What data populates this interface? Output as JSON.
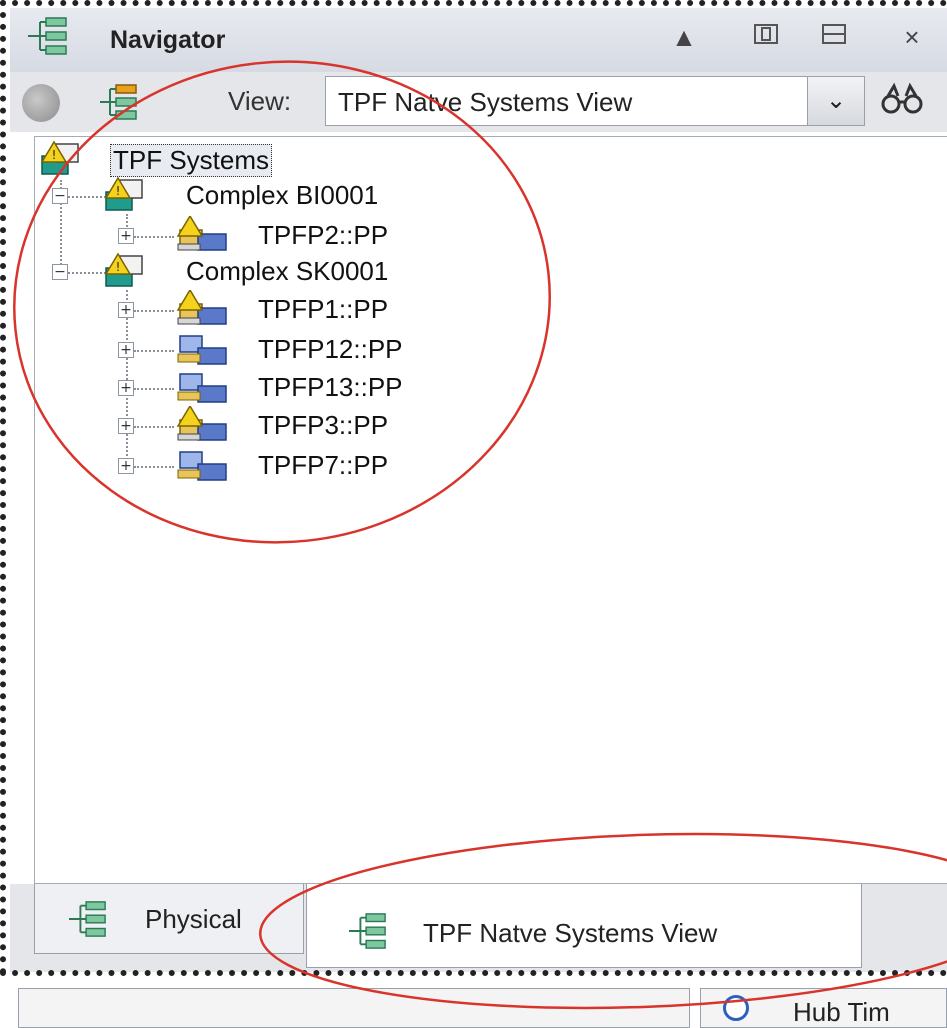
{
  "panel": {
    "title": "Navigator",
    "view_label": "View:",
    "view_value": "TPF Natve Systems View"
  },
  "tree": {
    "root": "TPF Systems",
    "complexes": [
      {
        "label": "Complex BI0001",
        "systems": [
          {
            "label": "TPFP2::PP",
            "status": "warning"
          }
        ]
      },
      {
        "label": "Complex SK0001",
        "systems": [
          {
            "label": "TPFP1::PP",
            "status": "warning"
          },
          {
            "label": "TPFP12::PP",
            "status": "normal"
          },
          {
            "label": "TPFP13::PP",
            "status": "normal"
          },
          {
            "label": "TPFP3::PP",
            "status": "warning"
          },
          {
            "label": "TPFP7::PP",
            "status": "normal"
          }
        ]
      }
    ]
  },
  "tabs": [
    {
      "label": "Physical"
    },
    {
      "label": "TPF Natve Systems View",
      "active": true
    }
  ],
  "statusbar": {
    "hub_label": "Hub Tim"
  },
  "colors": {
    "annotation": "#d9342b",
    "warning": "#f5d31c",
    "teal": "#1f9c8c",
    "computer": "#5a79c9"
  }
}
